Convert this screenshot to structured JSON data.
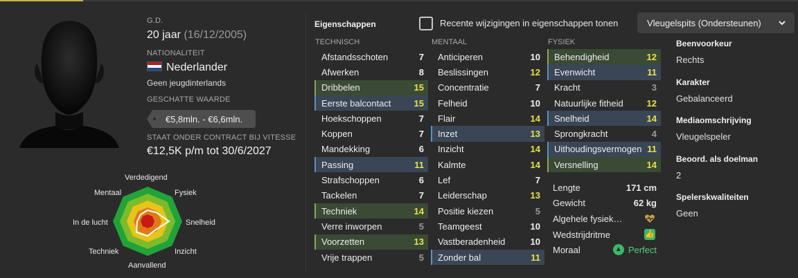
{
  "profile": {
    "position_short": "G.D.",
    "age": "20 jaar",
    "birthdate": "(16/12/2005)",
    "nationality_label": "NATIONALITEIT",
    "nationality": "Nederlander",
    "youth_caps": "Geen jeugdinterlands",
    "value_label": "GESCHATTE WAARDE",
    "value": "€5,8mln. - €6,6mln.",
    "contract_label": "STAAT ONDER CONTRACT BIJ VITESSE",
    "contract": "€12,5K p/m tot 30/6/2027"
  },
  "radar": {
    "labels": [
      "Verdedigend",
      "Fysiek",
      "Snelheid",
      "Inzicht",
      "Aanvallend",
      "Techniek",
      "In de lucht",
      "Mentaal"
    ],
    "values": [
      0.32,
      0.36,
      0.62,
      0.34,
      0.42,
      0.45,
      0.3,
      0.28
    ],
    "colors": {
      "ring1": "#21a33a",
      "ring2": "#7dbb2a",
      "ring3": "#e7c41a",
      "ring4": "#e07a16",
      "core": "#c81a14",
      "outline": "#ffffff"
    }
  },
  "header": {
    "title": "Eigenschappen",
    "checkbox_label": "Recente wijzigingen in eigenschappen tonen",
    "role": "Vleugelspits (Ondersteunen)"
  },
  "technisch": {
    "label": "TECHNISCH",
    "rows": [
      {
        "name": "Afstandsschoten",
        "value": "7",
        "hl": "",
        "color": "white"
      },
      {
        "name": "Afwerken",
        "value": "8",
        "hl": "",
        "color": "white"
      },
      {
        "name": "Dribbelen",
        "value": "15",
        "hl": "green",
        "color": "yellow"
      },
      {
        "name": "Eerste balcontact",
        "value": "15",
        "hl": "blue",
        "color": "yellow"
      },
      {
        "name": "Hoekschoppen",
        "value": "7",
        "hl": "",
        "color": "white"
      },
      {
        "name": "Koppen",
        "value": "7",
        "hl": "",
        "color": "white"
      },
      {
        "name": "Mandekking",
        "value": "6",
        "hl": "",
        "color": "white"
      },
      {
        "name": "Passing",
        "value": "11",
        "hl": "blue",
        "color": "yellow"
      },
      {
        "name": "Strafschoppen",
        "value": "6",
        "hl": "",
        "color": "white"
      },
      {
        "name": "Tackelen",
        "value": "7",
        "hl": "",
        "color": "white"
      },
      {
        "name": "Techniek",
        "value": "14",
        "hl": "green",
        "color": "yellow"
      },
      {
        "name": "Verre inworpen",
        "value": "5",
        "hl": "",
        "color": "grey"
      },
      {
        "name": "Voorzetten",
        "value": "13",
        "hl": "green",
        "color": "yellow"
      },
      {
        "name": "Vrije trappen",
        "value": "5",
        "hl": "",
        "color": "grey"
      }
    ]
  },
  "mentaal": {
    "label": "MENTAAL",
    "rows": [
      {
        "name": "Anticiperen",
        "value": "10",
        "hl": "",
        "color": "white"
      },
      {
        "name": "Beslissingen",
        "value": "12",
        "hl": "",
        "color": "yellow"
      },
      {
        "name": "Concentratie",
        "value": "7",
        "hl": "",
        "color": "white"
      },
      {
        "name": "Felheid",
        "value": "10",
        "hl": "",
        "color": "white"
      },
      {
        "name": "Flair",
        "value": "14",
        "hl": "",
        "color": "yellow"
      },
      {
        "name": "Inzet",
        "value": "13",
        "hl": "blue",
        "color": "yellow"
      },
      {
        "name": "Inzicht",
        "value": "14",
        "hl": "",
        "color": "yellow"
      },
      {
        "name": "Kalmte",
        "value": "14",
        "hl": "",
        "color": "yellow"
      },
      {
        "name": "Lef",
        "value": "7",
        "hl": "",
        "color": "white"
      },
      {
        "name": "Leiderschap",
        "value": "13",
        "hl": "",
        "color": "yellow"
      },
      {
        "name": "Positie kiezen",
        "value": "5",
        "hl": "",
        "color": "grey"
      },
      {
        "name": "Teamgeest",
        "value": "10",
        "hl": "",
        "color": "white"
      },
      {
        "name": "Vastberadenheid",
        "value": "10",
        "hl": "",
        "color": "white"
      },
      {
        "name": "Zonder bal",
        "value": "11",
        "hl": "blue",
        "color": "yellow"
      }
    ]
  },
  "fysiek": {
    "label": "FYSIEK",
    "rows": [
      {
        "name": "Behendigheid",
        "value": "12",
        "hl": "green",
        "color": "yellow"
      },
      {
        "name": "Evenwicht",
        "value": "11",
        "hl": "blue",
        "color": "yellow"
      },
      {
        "name": "Kracht",
        "value": "3",
        "hl": "",
        "color": "grey"
      },
      {
        "name": "Natuurlijke fitheid",
        "value": "12",
        "hl": "",
        "color": "yellow"
      },
      {
        "name": "Snelheid",
        "value": "14",
        "hl": "blue",
        "color": "yellow"
      },
      {
        "name": "Sprongkracht",
        "value": "4",
        "hl": "",
        "color": "grey"
      },
      {
        "name": "Uithoudingsvermogen",
        "value": "11",
        "hl": "blue",
        "color": "yellow"
      },
      {
        "name": "Versnelling",
        "value": "14",
        "hl": "green",
        "color": "yellow"
      }
    ]
  },
  "physical_info": {
    "length_label": "Lengte",
    "length": "171 cm",
    "weight_label": "Gewicht",
    "weight": "62 kg",
    "fitness_label": "Algehele fysieke conditie",
    "match_label": "Wedstrijdritme",
    "morale_label": "Moraal",
    "morale": "Perfect"
  },
  "side": [
    {
      "label": "Beenvoorkeur",
      "value": "Rechts"
    },
    {
      "label": "Karakter",
      "value": "Gebalanceerd"
    },
    {
      "label": "Mediaomschrijving",
      "value": "Vleugelspeler"
    },
    {
      "label": "Beoord. als doelman",
      "value": "2"
    },
    {
      "label": "Spelerskwaliteiten",
      "value": "Geen"
    }
  ]
}
